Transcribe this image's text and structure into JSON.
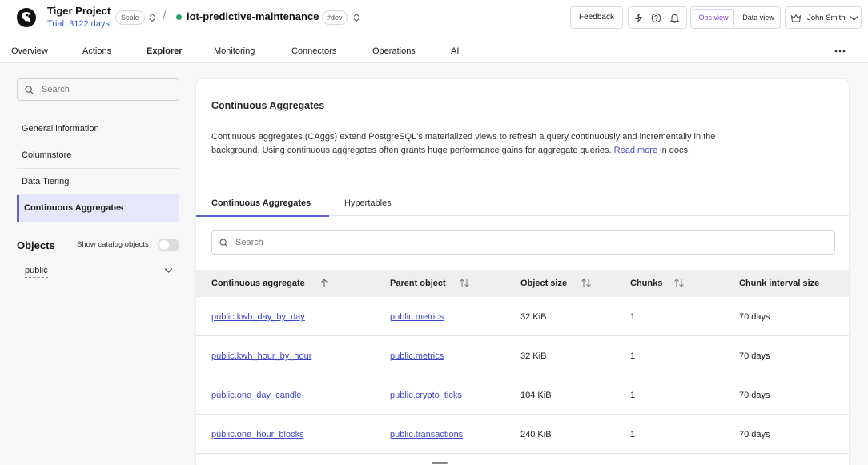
{
  "header": {
    "project_name": "Tiger Project",
    "trial": "Trial: 3122 days",
    "plan_badge": "Scale",
    "separator": "/",
    "service_name": "iot-predictive-maintenance",
    "env_badge": "#dev",
    "feedback_label": "Feedback",
    "ops_view_label": "Ops view",
    "data_view_label": "Data view",
    "user_name": "John Smith"
  },
  "nav": {
    "tabs": [
      "Overview",
      "Actions",
      "Explorer",
      "Monitoring",
      "Connectors",
      "Operations",
      "AI"
    ],
    "active": "Explorer"
  },
  "sidebar": {
    "search_placeholder": "Search",
    "items": [
      "General information",
      "Columnstore",
      "Data Tiering",
      "Continuous Aggregates"
    ],
    "active_item": "Continuous Aggregates",
    "objects_title": "Objects",
    "show_catalog_label": "Show catalog objects",
    "show_catalog_on": false,
    "schema": "public"
  },
  "main": {
    "title": "Continuous Aggregates",
    "description_1": "Continuous aggregates (CAggs) extend PostgreSQL's materialized views to refresh a query continuously and incrementally in the background. Using continuous aggregates often grants huge performance gains for aggregate queries. ",
    "read_more": "Read more",
    "description_2": " in docs.",
    "subtabs": [
      "Continuous Aggregates",
      "Hypertables"
    ],
    "active_subtab": "Continuous Aggregates",
    "search_placeholder": "Search",
    "columns": [
      "Continuous aggregate",
      "Parent object",
      "Object size",
      "Chunks",
      "Chunk interval size"
    ],
    "rows": [
      [
        "public.kwh_day_by_day",
        "public.metrics",
        "32 KiB",
        "1",
        "70 days"
      ],
      [
        "public.kwh_hour_by_hour",
        "public.metrics",
        "32 KiB",
        "1",
        "70 days"
      ],
      [
        "public.one_day_candle",
        "public.crypto_ticks",
        "104 KiB",
        "1",
        "70 days"
      ],
      [
        "public.one_hour_blocks",
        "public.transactions",
        "240 KiB",
        "1",
        "70 days"
      ]
    ]
  },
  "colors": {
    "accent": "#5e63d8",
    "link": "#3f48c8",
    "ops_view": "#7a3ee8",
    "status_green": "#22a35a",
    "trial_text": "#3a5bd6"
  }
}
